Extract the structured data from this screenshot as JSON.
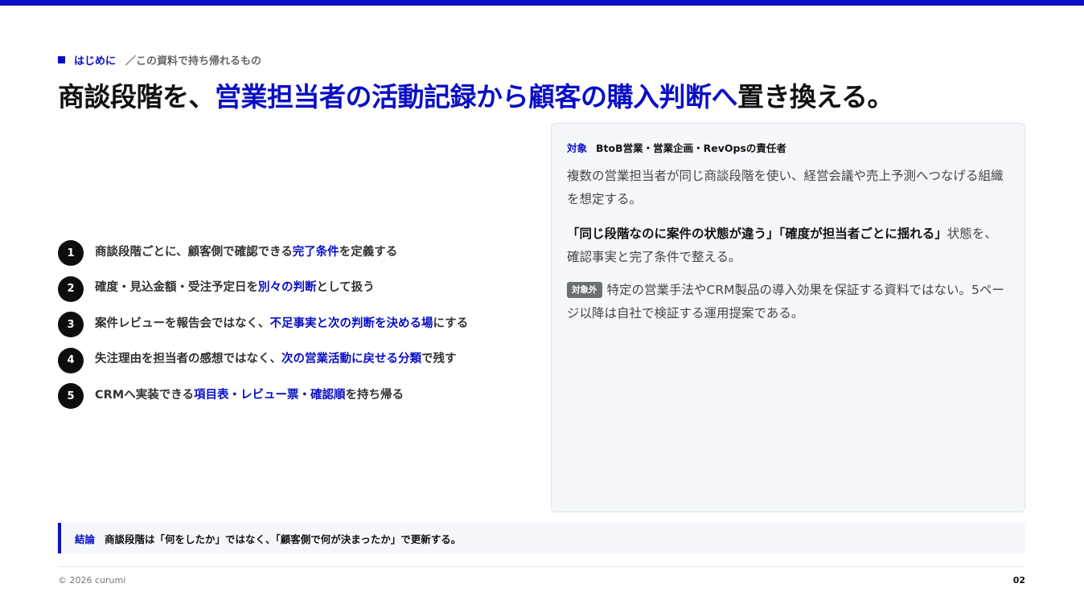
{
  "header": {
    "section_main": "はじめに",
    "section_sub": "／この資料で持ち帰れるもの"
  },
  "title": {
    "part1": "商談段階を、",
    "highlight": "営業担当者の活動記録から顧客の購入判断へ",
    "part2": "置き換える。"
  },
  "list": [
    {
      "num": "1",
      "pre": "商談段階ごとに、顧客側で確認できる",
      "hl": "完了条件",
      "post": "を定義する"
    },
    {
      "num": "2",
      "pre": "確度・見込金額・受注予定日を",
      "hl": "別々の判断",
      "post": "として扱う"
    },
    {
      "num": "3",
      "pre": "案件レビューを報告会ではなく、",
      "hl": "不足事実と次の判断を決める場",
      "post": "にする"
    },
    {
      "num": "4",
      "pre": "失注理由を担当者の感想ではなく、",
      "hl": "次の営業活動に戻せる分類",
      "post": "で残す"
    },
    {
      "num": "5",
      "pre": "CRMへ実装できる",
      "hl": "項目表・レビュー票・確認順",
      "post": "を持ち帰る"
    }
  ],
  "panel": {
    "target_label": "対象",
    "target_value": "BtoB営業・営業企画・RevOpsの責任者",
    "para1": "複数の営業担当者が同じ商談段階を使い、経営会議や売上予測へつなげる組織を想定する。",
    "para2_strong": "「同じ段階なのに案件の状態が違う」「確度が担当者ごとに揺れる」",
    "para2_rest": "状態を、確認事実と完了条件で整える。",
    "badge": "対象外",
    "para3": "特定の営業手法やCRM製品の導入効果を保証する資料ではない。5ページ以降は自社で検証する運用提案である。"
  },
  "conclusion": {
    "label": "結論",
    "text": "商談段階は「何をしたか」ではなく、「顧客側で何が決まったか」で更新する。"
  },
  "footer": {
    "copyright": "© 2026 curumi",
    "page": "02"
  },
  "colors": {
    "accent": "#0a0fc4",
    "panel_bg": "#f5f7fb"
  }
}
